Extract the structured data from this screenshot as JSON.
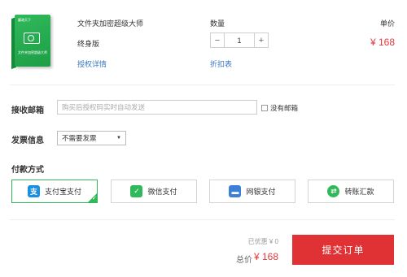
{
  "product": {
    "box_logo": "赢政天下",
    "box_name": "文件夹加密超级大师",
    "title": "文件夹加密超级大师",
    "edition": "终身版",
    "license_link": "授权详情"
  },
  "quantity": {
    "header": "数量",
    "minus": "−",
    "value": "1",
    "plus": "+",
    "compare_link": "折扣表"
  },
  "price": {
    "header": "单价",
    "value": "¥ 168"
  },
  "form": {
    "email_label": "接收邮箱",
    "email_placeholder": "购买后授权码实时自动发送",
    "email_value": "",
    "no_email_label": "没有邮箱",
    "invoice_label": "发票信息",
    "invoice_selected": "不需要发票",
    "invoice_arrow": "▼"
  },
  "payment": {
    "title": "付款方式",
    "options": [
      {
        "label": "支付宝支付",
        "icon": "alipay-icon",
        "glyph": "支",
        "color": "#1a8ee1",
        "selected": true
      },
      {
        "label": "微信支付",
        "icon": "wechat-icon",
        "glyph": "✓",
        "color": "#2fb95a",
        "selected": false
      },
      {
        "label": "网银支付",
        "icon": "bank-card-icon",
        "glyph": "▬",
        "color": "#3b7fd6",
        "selected": false
      },
      {
        "label": "转账汇款",
        "icon": "transfer-icon",
        "glyph": "⇄",
        "color": "#2fb95a",
        "selected": false
      }
    ]
  },
  "summary": {
    "discount": "已优惠 ¥ 0",
    "total_label": "总价",
    "total_value": "¥ 168",
    "submit_label": "提交订单"
  },
  "colors": {
    "accent_red": "#e03235",
    "link_blue": "#3a78c3",
    "selected_green": "#2fb95a"
  }
}
